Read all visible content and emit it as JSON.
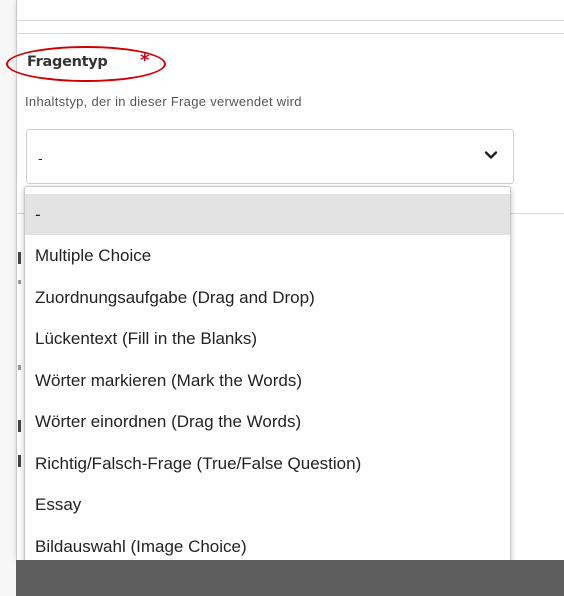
{
  "field": {
    "title": "Fragentyp",
    "required_mark": "*",
    "description": "Inhaltstyp, der in dieser Frage verwendet wird"
  },
  "select": {
    "current_value": "-",
    "icon": "chevron-down-icon"
  },
  "dropdown": {
    "options": [
      {
        "label": "-"
      },
      {
        "label": "Multiple Choice"
      },
      {
        "label": "Zuordnungsaufgabe (Drag and Drop)"
      },
      {
        "label": "Lückentext (Fill in the Blanks)"
      },
      {
        "label": "Wörter markieren (Mark the Words)"
      },
      {
        "label": "Wörter einordnen (Drag the Words)"
      },
      {
        "label": "Richtig/Falsch-Frage (True/False Question)"
      },
      {
        "label": "Essay"
      },
      {
        "label": "Bildauswahl (Image Choice)"
      }
    ]
  },
  "colors": {
    "required": "#d0021b",
    "highlight_ring": "#d10000",
    "selected_option_bg": "#e3e3e3",
    "footer_bar": "#5e5e5e"
  }
}
